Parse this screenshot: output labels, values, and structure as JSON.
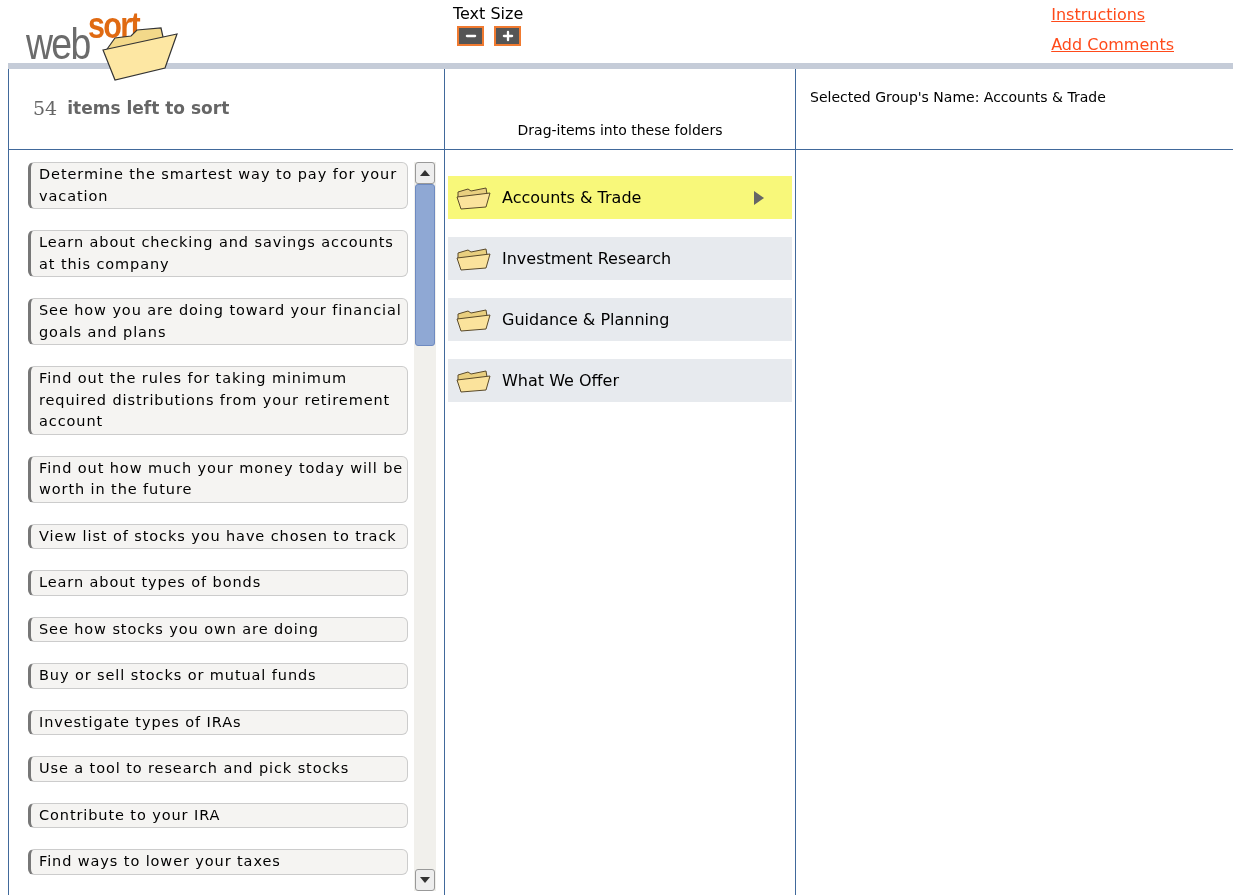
{
  "logo": {
    "part_1": "web",
    "part_2": "sort"
  },
  "text_size": {
    "label": "Text Size"
  },
  "links": [
    "Instructions",
    "Add Comments"
  ],
  "items_left": {
    "count": "54",
    "label": "items left to sort"
  },
  "folders_header": "Drag-items into these folders",
  "selected_group": "Selected Group's Name: Accounts & Trade",
  "items": [
    "Determine the smartest way to pay for your vacation",
    "Learn about checking and savings accounts at this company",
    "See how you are doing toward your financial goals and plans",
    "Find out the rules for taking minimum required distributions from your retirement account",
    "Find out how much your money today will be worth in the future",
    "View list of stocks you have chosen to track",
    "Learn about types of bonds",
    "See how stocks you own are doing",
    "Buy or sell stocks or mutual funds",
    "Investigate types of IRAs",
    "Use a tool to research and pick stocks",
    "Contribute to your IRA",
    "Find ways to lower your taxes"
  ],
  "folders": [
    {
      "name": "Accounts & Trade",
      "selected": true
    },
    {
      "name": "Investment Research",
      "selected": false
    },
    {
      "name": "Guidance & Planning",
      "selected": false
    },
    {
      "name": "What We Offer",
      "selected": false
    }
  ]
}
